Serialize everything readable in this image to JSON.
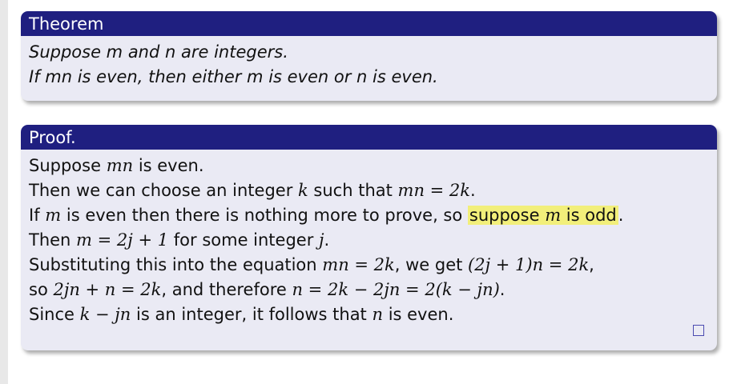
{
  "theorem": {
    "title": "Theorem",
    "line1": "Suppose m and n are integers.",
    "line2": "If mn is even, then either m is even or n is even."
  },
  "proof": {
    "title": "Proof.",
    "l1": {
      "a": "Suppose ",
      "b": "mn",
      "c": " is even."
    },
    "l2": {
      "a": "Then we can choose an integer ",
      "b": "k",
      "c": " such that ",
      "d": "mn = 2k",
      "e": "."
    },
    "l3": {
      "a": "If ",
      "b": "m",
      "c": " is even then there is nothing more to prove, so ",
      "h1": "suppose ",
      "h2": "m",
      "h3": " is odd",
      "d": "."
    },
    "l4": {
      "a": "Then ",
      "b": "m = 2j + 1",
      "c": " for some integer ",
      "d": "j",
      "e": "."
    },
    "l5": {
      "a": "Substituting this into the equation ",
      "b": "mn = 2k",
      "c": ", we get ",
      "d": "(2j + 1)n = 2k",
      "e": ","
    },
    "l6": {
      "a": "so ",
      "b": "2jn + n = 2k",
      "c": ", and therefore ",
      "d": "n = 2k − 2jn = 2(k − jn)",
      "e": "."
    },
    "l7": {
      "a": "Since ",
      "b": "k − jn",
      "c": " is an integer, it follows that ",
      "d": "n",
      "e": " is even."
    }
  },
  "colors": {
    "header": "#1f1f80",
    "body": "#eaeaf4",
    "highlight": "#f2ef7a"
  },
  "icons": {
    "qed": "qed-square-icon"
  }
}
